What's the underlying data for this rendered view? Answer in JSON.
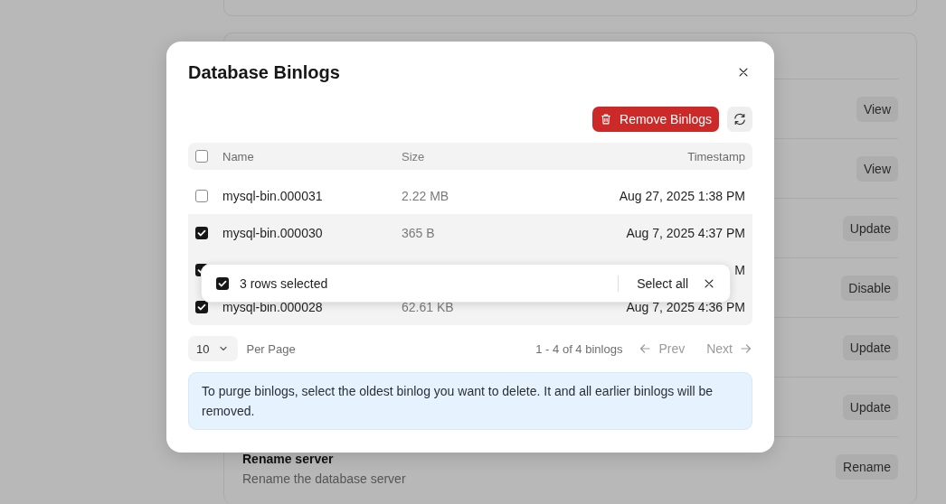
{
  "background_settings": [
    {
      "button": "View"
    },
    {
      "button": "View"
    },
    {
      "button": "Update"
    },
    {
      "button": "Disable"
    },
    {
      "button": "Update"
    },
    {
      "button": "Update"
    },
    {
      "title": "Rename server",
      "description": "Rename the database server",
      "button": "Rename"
    }
  ],
  "dialog": {
    "title": "Database Binlogs",
    "remove_button": "Remove Binlogs",
    "table": {
      "select_all_checked": false,
      "columns": [
        "Name",
        "Size",
        "Timestamp"
      ],
      "rows": [
        {
          "name": "mysql-bin.000031",
          "size": "2.22 MB",
          "timestamp": "Aug 27, 2025 1:38 PM",
          "selected": false
        },
        {
          "name": "mysql-bin.000030",
          "size": "365 B",
          "timestamp": "Aug 7, 2025 4:37 PM",
          "selected": true
        },
        {
          "timestamp": "M",
          "selected": true
        },
        {
          "name": "mysql-bin.000028",
          "size": "62.61 KB",
          "timestamp": "Aug 7, 2025 4:36 PM",
          "selected": true
        }
      ]
    },
    "selection_bar": {
      "checked": true,
      "label": "3 rows selected",
      "select_all": "Select all"
    },
    "footer": {
      "per_page": "10",
      "per_page_label": "Per Page",
      "range": "1 - 4 of 4 binlogs",
      "prev": {
        "label": "Prev",
        "disabled": true
      },
      "next": {
        "label": "Next",
        "disabled": true
      }
    },
    "info": "To purge binlogs, select the oldest binlog you want to delete. It and all earlier binlogs will be removed."
  }
}
